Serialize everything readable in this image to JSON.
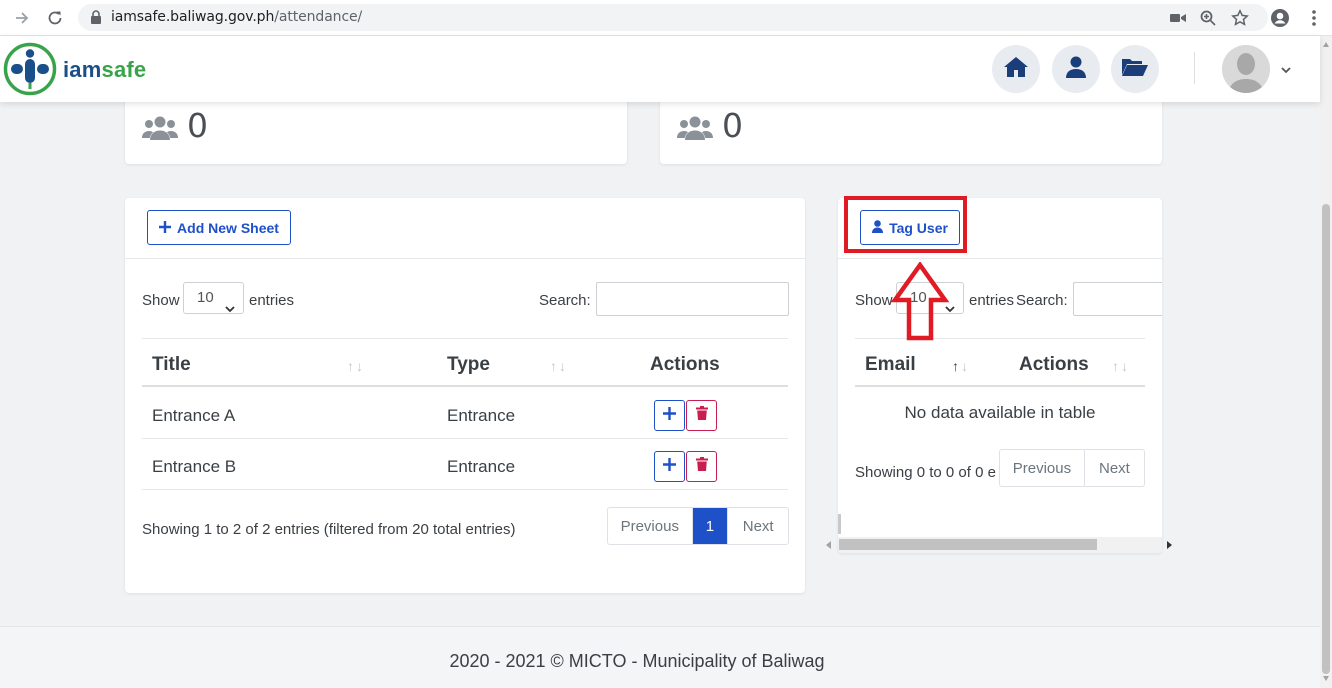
{
  "browser": {
    "url_host": "iamsafe.baliwag.gov.ph",
    "url_path": "/attendance/"
  },
  "brand": {
    "part1": "iam",
    "part2": "safe"
  },
  "stats": [
    {
      "value": "0"
    },
    {
      "value": "0"
    }
  ],
  "sheets": {
    "add_button_label": "Add New Sheet",
    "show_label": "Show",
    "entries_value": "10",
    "entries_label": "entries",
    "search_label": "Search:",
    "columns": [
      "Title",
      "Type",
      "Actions"
    ],
    "rows": [
      {
        "title": "Entrance A",
        "type": "Entrance"
      },
      {
        "title": "Entrance B",
        "type": "Entrance"
      }
    ],
    "info": "Showing 1 to 2 of 2 entries (filtered from 20 total entries)",
    "pagination": {
      "previous": "Previous",
      "page": "1",
      "next": "Next"
    }
  },
  "tagged": {
    "tag_button_label": "Tag User",
    "show_label": "Show",
    "entries_value": "10",
    "entries_label": "entries",
    "search_label": "Search:",
    "columns": [
      "Email",
      "Actions"
    ],
    "empty_message": "No data available in table",
    "info": "Showing 0 to 0 of 0 e",
    "pagination": {
      "previous": "Previous",
      "next": "Next"
    }
  },
  "footer": {
    "text": "2020 - 2021 © MICTO - Municipality of Baliwag"
  },
  "colors": {
    "primary": "#1e50c8",
    "danger": "#c81e50",
    "brand_blue": "#1b4f8a",
    "brand_green": "#39a34a",
    "annotation_red": "#e01b24"
  }
}
